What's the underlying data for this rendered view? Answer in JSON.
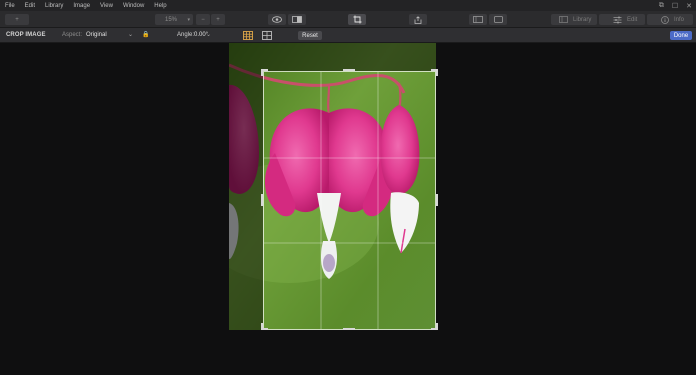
{
  "menu": [
    "File",
    "Edit",
    "Library",
    "Image",
    "View",
    "Window",
    "Help"
  ],
  "window_controls": [
    "restore-icon",
    "maximize-icon",
    "close-icon"
  ],
  "toolbar": {
    "zoom": "15%",
    "zoom_minus": "−",
    "zoom_plus": "+",
    "library_label": "Library",
    "edit_label": "Edit",
    "info_label": "Info"
  },
  "crop": {
    "title": "CROP IMAGE",
    "aspect_label": "Aspect:",
    "aspect_value": "Original",
    "angle_label": "Angle:",
    "angle_value": "0.00°",
    "reset_label": "Reset",
    "done_label": "Done"
  },
  "colors": {
    "accent": "#4c6bc7",
    "lock": "#e0a84a",
    "grid_active": "#e0a84a"
  }
}
